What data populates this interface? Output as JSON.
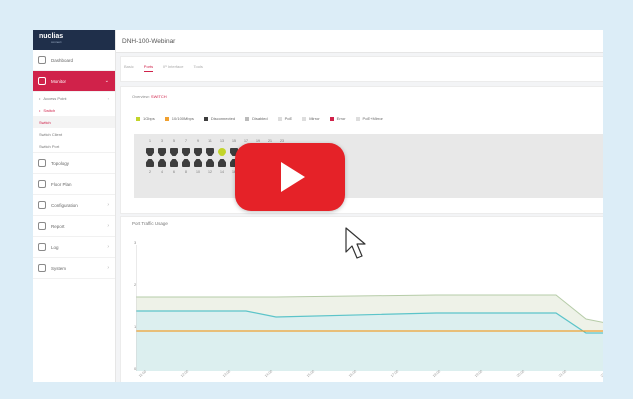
{
  "app": {
    "logo": "nuclias",
    "logo_sub": "connect",
    "page_title": "DNH-100-Webinar"
  },
  "sidebar": {
    "dashboard": "Dashboard",
    "monitor": "Monitor",
    "access_point": "Access Point",
    "switch": "Switch",
    "switch_sub": "Switch",
    "switch_client": "Switch Client",
    "switch_port": "Switch Port",
    "topology": "Topology",
    "floor_plan": "Floor Plan",
    "configuration": "Configuration",
    "report": "Report",
    "log": "Log",
    "system": "System"
  },
  "tabs": [
    "Basic",
    "Ports",
    "IP Interface",
    "Tools"
  ],
  "overview": {
    "label": "Overview:",
    "value": "SWITCH"
  },
  "legend": [
    {
      "label": "1Gbps",
      "color": "#c2d42a"
    },
    {
      "label": "10/100Mbps",
      "color": "#f0a030"
    },
    {
      "label": "Disconnected",
      "color": "#3d3d3d"
    },
    {
      "label": "Disabled",
      "color": "#bbbbbb"
    },
    {
      "label": "PoE",
      "color": "#dddddd"
    },
    {
      "label": "Mirror",
      "color": "#dddddd"
    },
    {
      "label": "Error",
      "color": "#d0224a"
    },
    {
      "label": "PoE+Mirror",
      "color": "#dddddd"
    }
  ],
  "ports": {
    "top_numbers": [
      "1",
      "3",
      "5",
      "7",
      "9",
      "11",
      "13",
      "15",
      "17",
      "19",
      "21",
      "23"
    ],
    "bottom_numbers": [
      "2",
      "4",
      "6",
      "8",
      "10",
      "12",
      "14",
      "16",
      "18",
      "20",
      "22",
      "24"
    ],
    "active_port_index_top": 6
  },
  "traffic": {
    "title": "Port Traffic Usage",
    "y_labels": [
      "3",
      "2",
      "1",
      "0"
    ],
    "x_labels": [
      "11:00",
      "12:00",
      "13:00",
      "14:00",
      "15:00",
      "16:00",
      "17:00",
      "18:00",
      "19:00",
      "20:00",
      "21:00",
      "22:00"
    ]
  },
  "colors": {
    "accent": "#d0224a",
    "play": "#e52228"
  }
}
